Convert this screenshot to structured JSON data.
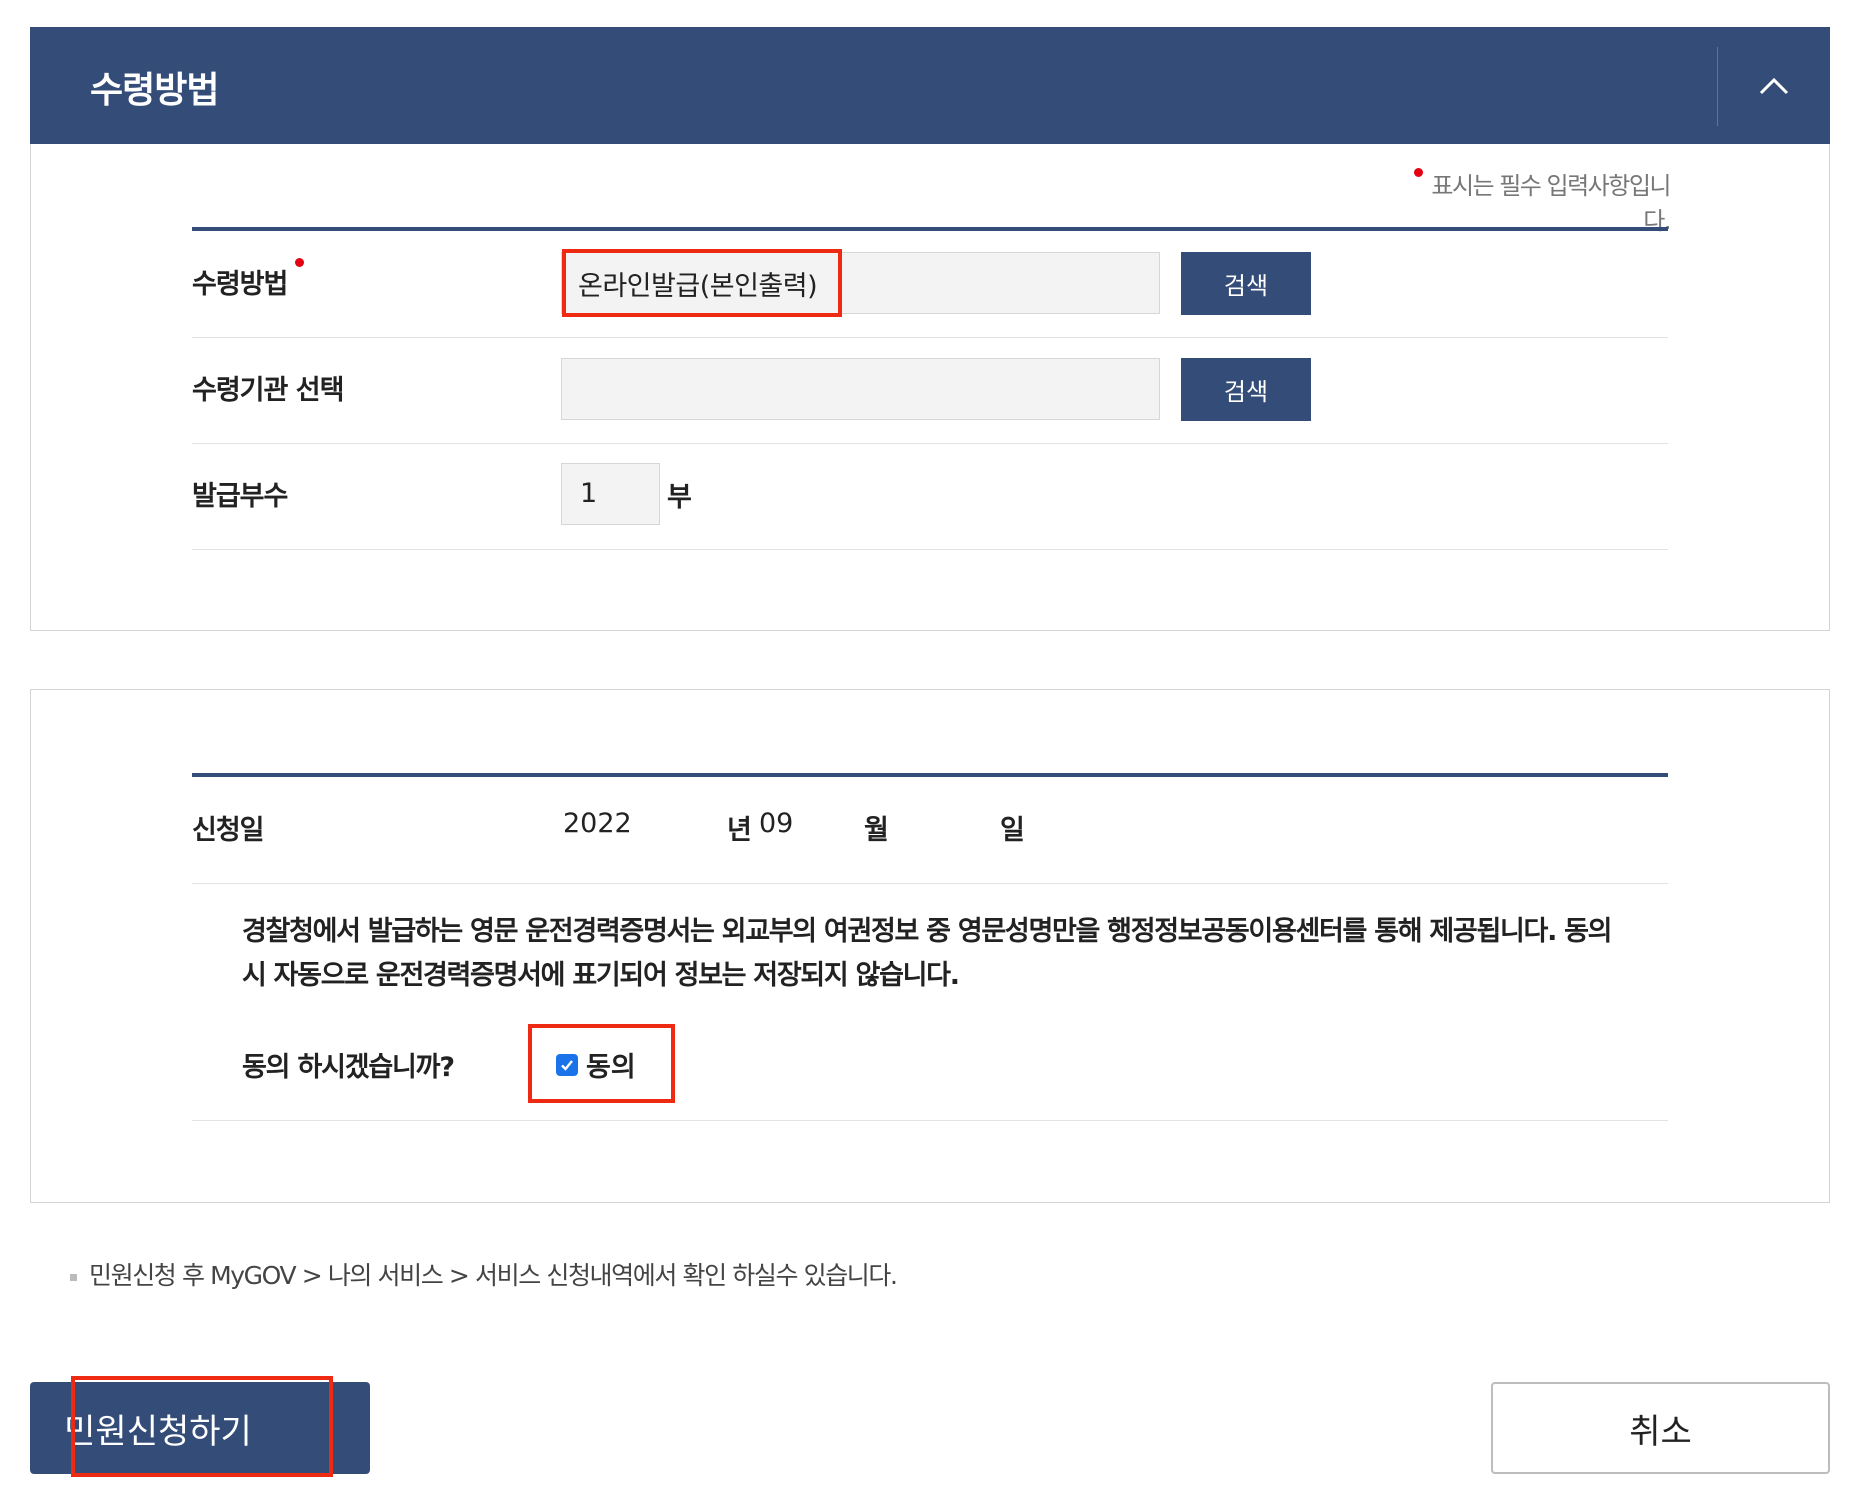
{
  "receipt_section": {
    "title": "수령방법",
    "collapse_icon": "chevron-up-icon",
    "required_note": "표시는 필수 입력사항입니다.",
    "required_color": "#e50012",
    "method": {
      "label": "수령방법",
      "value": "온라인발급(본인출력)",
      "button": "검색"
    },
    "agency": {
      "label": "수령기관 선택",
      "value": "",
      "button": "검색"
    },
    "copies": {
      "label": "발급부수",
      "value": "1",
      "unit": "부"
    }
  },
  "application_section": {
    "date_label": "신청일",
    "year": "2022",
    "year_unit": "년",
    "month": "09",
    "month_unit": "월",
    "day_unit": "일",
    "notice": "경찰청에서 발급하는 영문 운전경력증명서는 외교부의 여권정보 중 영문성명만을 행정정보공동이용센터를 통해 제공됩니다. 동의 시 자동으로 운전경력증명서에 표기되어 정보는 저장되지 않습니다.",
    "agree_question": "동의 하시겠습니까?",
    "agree_label": "동의",
    "agree_checked": true
  },
  "footer_note": "민원신청 후 MyGOV > 나의 서비스 > 서비스 신청내역에서 확인 하실수 있습니다.",
  "buttons": {
    "submit": "민원신청하기",
    "cancel": "취소"
  },
  "colors": {
    "primary": "#344d78",
    "highlight": "#ee2b12",
    "checkbox": "#1a73e8"
  }
}
